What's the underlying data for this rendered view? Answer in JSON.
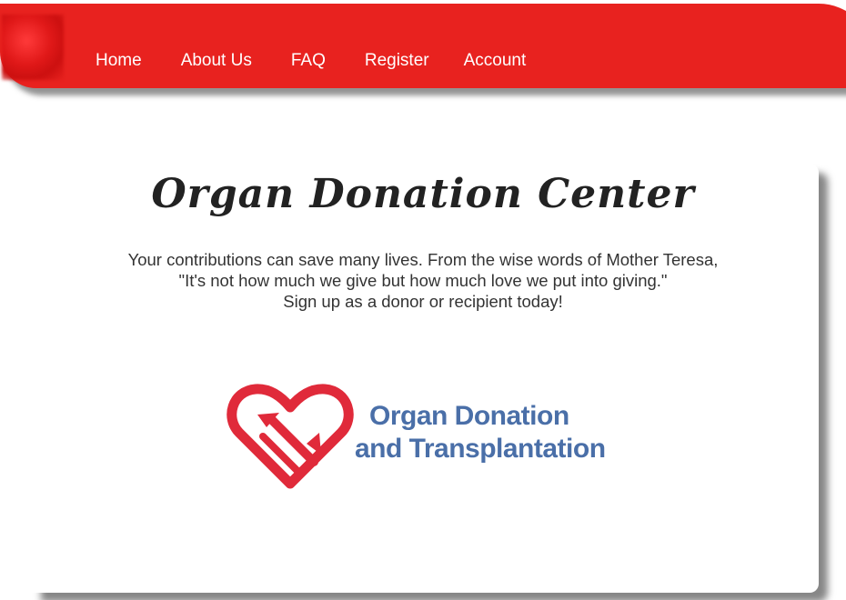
{
  "nav": {
    "items": [
      {
        "label": "Home"
      },
      {
        "label": "About Us"
      },
      {
        "label": "FAQ"
      },
      {
        "label": "Register"
      },
      {
        "label": "Account"
      }
    ],
    "color": "#e8221f"
  },
  "main": {
    "title": "Organ Donation Center",
    "intro_lines": [
      "Your contributions can save many lives. From the wise words of Mother Teresa,",
      "\"It's not how much we give but how much love we put into giving.\"",
      "Sign up as a donor or recipient today!"
    ],
    "logo": {
      "line1": "Organ Donation",
      "line2": "and Transplantation",
      "heart_color": "#e02a3a",
      "text_color": "#4a6fa8"
    }
  }
}
